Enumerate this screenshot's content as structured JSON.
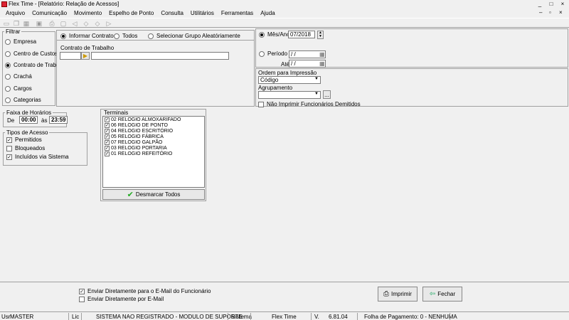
{
  "window": {
    "title": "Flex Time - [Relatório: Relação de Acessos]",
    "minimize": "_",
    "maximize": "□",
    "close": "×",
    "mdi_min": "–",
    "mdi_max": "▫",
    "mdi_close": "×"
  },
  "menu": [
    "Arquivo",
    "Comunicação",
    "Movimento",
    "Espelho de Ponto",
    "Consulta",
    "Utilitários",
    "Ferramentas",
    "Ajuda"
  ],
  "filtrar": {
    "legend": "Filtrar",
    "options": [
      "Empresa",
      "Centro de Custos",
      "Contrato de Trabalho",
      "Crachá",
      "Cargos",
      "Categorias"
    ],
    "selected": 2
  },
  "contrato": {
    "options": [
      "Informar Contrato",
      "Todos",
      "Selecionar Grupo Aleatóriamente"
    ],
    "selected": 0,
    "field_label": "Contrato de Trabalho",
    "code_value": "",
    "desc_value": ""
  },
  "periodo": {
    "mes_ano_label": "Mês/Ano",
    "mes_ano_value": "07/2018",
    "periodo_label": "Período de",
    "periodo_de_value": " /  /",
    "ate_label": "Até",
    "ate_value": " /  /"
  },
  "ordem": {
    "label": "Ordem para Impressão",
    "value": "Código",
    "agrupamento_label": "Agrupamento",
    "agrupamento_value": "",
    "ellipsis": "...",
    "nao_imprimir_label": "Não Imprimir Funcionários Demitidos"
  },
  "faixa": {
    "legend": "Faixa de Horários",
    "de_label": "De",
    "de_value": "00:00",
    "as_label": "às",
    "as_value": "23:59"
  },
  "tipos": {
    "legend": "Tipos de Acesso",
    "items": [
      {
        "label": "Permitidos",
        "checked": true
      },
      {
        "label": "Bloqueados",
        "checked": false
      },
      {
        "label": "Incluídos via Sistema",
        "checked": true
      }
    ]
  },
  "terminais": {
    "legend": "Terminais",
    "items": [
      "02 RELOGIO ALMOXARIFADO",
      "06 RELOGIO DE PONTO",
      "04 RELOGIO ESCRITÓRIO",
      "05 RELOGIO FÁBRICA",
      "07 RELOGIO GALPÃO",
      "03 RELOGIO PORTARIA",
      "01 RELOGIO REFEITÓRIO"
    ],
    "desmarcar_label": "Desmarcar Todos"
  },
  "email": {
    "direto_funcionario": "Enviar Diretamente para o E-Mail do Funcionário",
    "direto_funcionario_checked": true,
    "por_email": "Enviar Diretamente por E-Mail",
    "por_email_checked": false
  },
  "actions": {
    "imprimir": "Imprimir",
    "fechar": "Fechar"
  },
  "status": {
    "usr_label": "Usr",
    "usr_value": "MASTER",
    "lic_label": "Lic",
    "lic_value": "SISTEMA NAO REGISTRADO - MODULO DE SUPORTE",
    "sistema_label": "Sistema",
    "sistema_value": "Flex Time",
    "versao_label": "V.",
    "versao_value": "6.81.04",
    "folha": "Folha de Pagamento: 0 - NENHUMA"
  }
}
